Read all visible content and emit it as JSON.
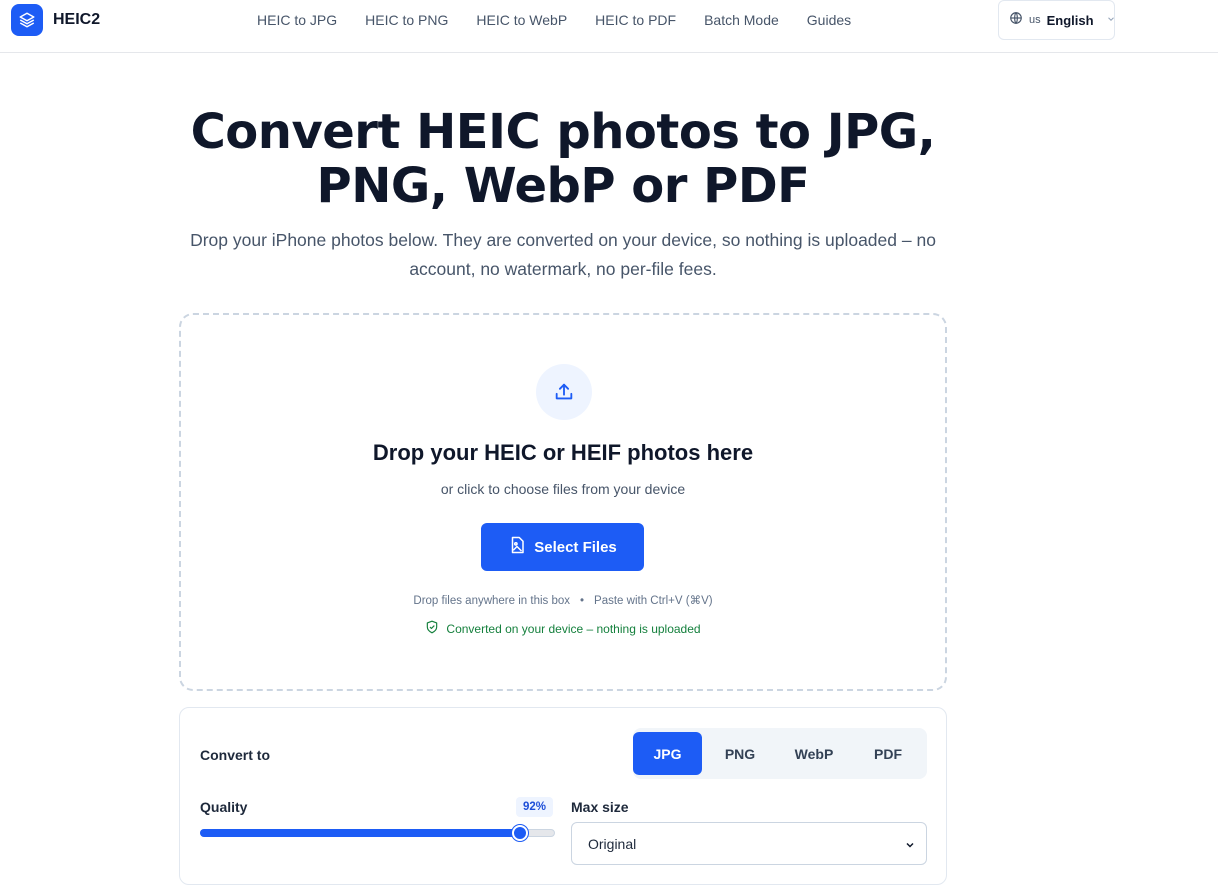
{
  "header": {
    "logo_text": "HEIC2",
    "nav": [
      "HEIC to JPG",
      "HEIC to PNG",
      "HEIC to WebP",
      "HEIC to PDF",
      "Batch Mode",
      "Guides"
    ],
    "lang_code": "us",
    "lang_label": "English"
  },
  "hero": {
    "title_line1": "Convert HEIC photos to JPG,",
    "title_line2": "PNG, WebP or PDF",
    "subtitle": "Drop your iPhone photos below. They are converted on your device, so nothing is uploaded – no account, no watermark, no per-file fees."
  },
  "dropzone": {
    "title": "Drop your HEIC or HEIF photos here",
    "subtitle": "or click to choose files from your device",
    "button_label": "Select Files",
    "hint_drop": "Drop files anywhere in this box",
    "hint_sep": "•",
    "hint_paste": "Paste with Ctrl+V (⌘V)",
    "safe_text": "Converted on your device – nothing is uploaded"
  },
  "settings": {
    "convert_label": "Convert to",
    "formats": [
      "JPG",
      "PNG",
      "WebP",
      "PDF"
    ],
    "active_format": "JPG",
    "quality_label": "Quality",
    "quality_value": "92%",
    "quality_fraction": 0.92,
    "max_size_label": "Max size",
    "max_size_value": "Original"
  },
  "colors": {
    "accent": "#1d5cf5",
    "success": "#15803d"
  },
  "icons": [
    "layers-icon",
    "globe-icon",
    "chevron-down-icon",
    "upload-icon",
    "image-file-icon",
    "shield-check-icon"
  ]
}
